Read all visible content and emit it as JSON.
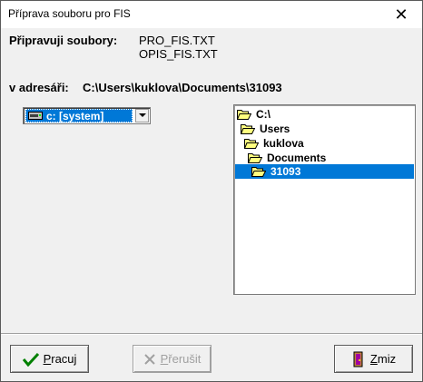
{
  "window": {
    "title": "Příprava souboru pro FIS",
    "close_symbol": "✕"
  },
  "files": {
    "label": "Připravuji soubory:",
    "items": [
      "PRO_FIS.TXT",
      "OPIS_FIS.TXT"
    ]
  },
  "directory": {
    "label": "v adresáři:",
    "path": "C:\\Users\\kuklova\\Documents\\31093"
  },
  "drive_select": {
    "value": "c: [system]"
  },
  "tree": {
    "nodes": [
      {
        "label": "C:\\",
        "level": 0,
        "selected": false
      },
      {
        "label": "Users",
        "level": 1,
        "selected": false
      },
      {
        "label": "kuklova",
        "level": 2,
        "selected": false
      },
      {
        "label": "Documents",
        "level": 3,
        "selected": false
      },
      {
        "label": "31093",
        "level": 4,
        "selected": true
      }
    ]
  },
  "buttons": {
    "run": {
      "accel": "P",
      "rest": "racuj",
      "enabled": true
    },
    "abort": {
      "accel": "P",
      "rest": "řerušit",
      "enabled": false
    },
    "cancel": {
      "accel": "Z",
      "rest": "miz",
      "enabled": true
    }
  },
  "colors": {
    "selection": "#0078d7",
    "folder": "#ffff80"
  }
}
